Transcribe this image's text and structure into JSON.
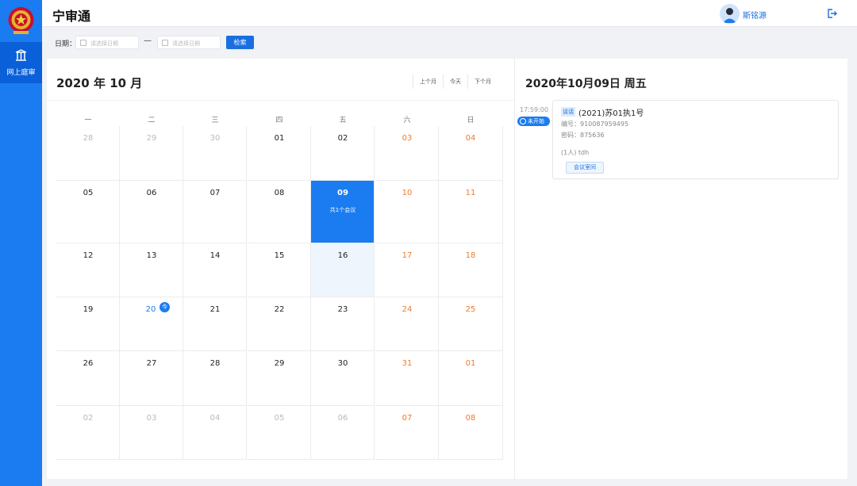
{
  "app": {
    "title": "宁审通"
  },
  "sidebar": {
    "items": [
      {
        "label": "网上庭审",
        "icon": "court-icon"
      }
    ]
  },
  "header": {
    "username": "斯铭源"
  },
  "filter": {
    "label": "日期：",
    "start_placeholder": "请选择日期",
    "end_placeholder": "请选择日期",
    "separator": "—",
    "search_label": "检索"
  },
  "calendar": {
    "title": "2020 年 10 月",
    "nav": {
      "prev": "上个月",
      "today": "今天",
      "next": "下个月"
    },
    "weekdays": [
      "一",
      "二",
      "三",
      "四",
      "五",
      "六",
      "日"
    ],
    "today_badge": "今",
    "meeting_count": "共1个会议",
    "weeks": [
      [
        {
          "d": "28",
          "other": true
        },
        {
          "d": "29",
          "other": true
        },
        {
          "d": "30",
          "other": true
        },
        {
          "d": "01"
        },
        {
          "d": "02"
        },
        {
          "d": "03",
          "weekend": true
        },
        {
          "d": "04",
          "weekend": true
        }
      ],
      [
        {
          "d": "05"
        },
        {
          "d": "06"
        },
        {
          "d": "07"
        },
        {
          "d": "08"
        },
        {
          "d": "09",
          "selected": true
        },
        {
          "d": "10",
          "weekend": true
        },
        {
          "d": "11",
          "weekend": true
        }
      ],
      [
        {
          "d": "12"
        },
        {
          "d": "13"
        },
        {
          "d": "14"
        },
        {
          "d": "15"
        },
        {
          "d": "16",
          "highlight": true
        },
        {
          "d": "17",
          "weekend": true
        },
        {
          "d": "18",
          "weekend": true
        }
      ],
      [
        {
          "d": "19"
        },
        {
          "d": "20",
          "today": true
        },
        {
          "d": "21"
        },
        {
          "d": "22"
        },
        {
          "d": "23"
        },
        {
          "d": "24",
          "weekend": true
        },
        {
          "d": "25",
          "weekend": true
        }
      ],
      [
        {
          "d": "26"
        },
        {
          "d": "27"
        },
        {
          "d": "28"
        },
        {
          "d": "29"
        },
        {
          "d": "30"
        },
        {
          "d": "31",
          "weekend": true
        },
        {
          "d": "01",
          "weekend": true,
          "other": true
        }
      ],
      [
        {
          "d": "02",
          "other": true
        },
        {
          "d": "03",
          "other": true
        },
        {
          "d": "04",
          "other": true
        },
        {
          "d": "05",
          "other": true
        },
        {
          "d": "06",
          "other": true
        },
        {
          "d": "07",
          "weekend": true,
          "other": true
        },
        {
          "d": "08",
          "weekend": true,
          "other": true
        }
      ]
    ]
  },
  "detail": {
    "title": "2020年10月09日 周五",
    "meetings": [
      {
        "time": "17:59:00",
        "status": "未开始",
        "tag": "谈话",
        "case_no": "(2021)苏01执1号",
        "number": "编号：910087959495",
        "password": "密码：875636",
        "participants": "(1人) tdh",
        "room_button": "会议室间"
      }
    ]
  },
  "colors": {
    "primary": "#1a7cf0",
    "weekend": "#f07a2e",
    "sidebar": "#1a7cf0"
  }
}
